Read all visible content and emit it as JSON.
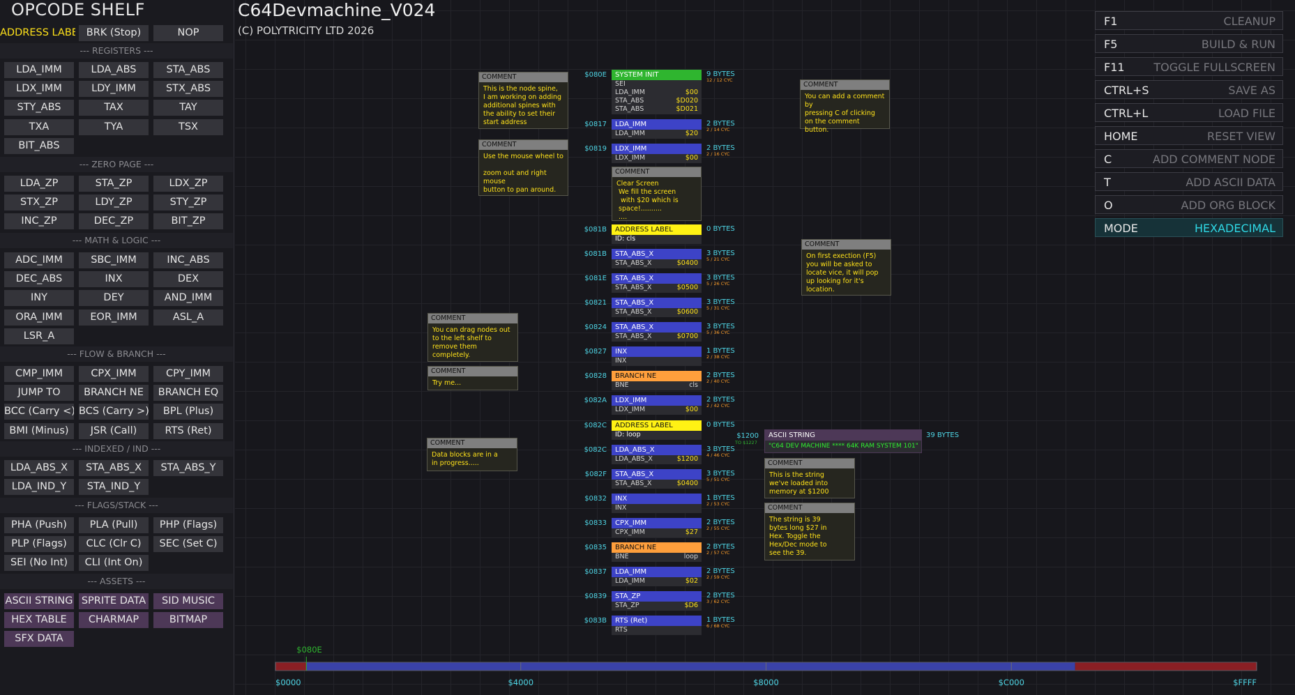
{
  "shelf": {
    "title": "OPCODE SHELF",
    "top": [
      "ADDRESS LABEL",
      "BRK (Stop)",
      "NOP"
    ],
    "sections": {
      "registers": "--- REGISTERS ---",
      "zeropage": "--- ZERO PAGE ---",
      "math": "--- MATH & LOGIC ---",
      "flow": "--- FLOW & BRANCH ---",
      "indexed": "--- INDEXED / IND ---",
      "flags": "--- FLAGS/STACK ---",
      "assets": "--- ASSETS ---"
    },
    "registers": [
      "LDA_IMM",
      "LDA_ABS",
      "STA_ABS",
      "LDX_IMM",
      "LDY_IMM",
      "STX_ABS",
      "STY_ABS",
      "TAX",
      "TAY",
      "TXA",
      "TYA",
      "TSX",
      "BIT_ABS"
    ],
    "zeropage": [
      "LDA_ZP",
      "STA_ZP",
      "LDX_ZP",
      "STX_ZP",
      "LDY_ZP",
      "STY_ZP",
      "INC_ZP",
      "DEC_ZP",
      "BIT_ZP"
    ],
    "math": [
      "ADC_IMM",
      "SBC_IMM",
      "INC_ABS",
      "DEC_ABS",
      "INX",
      "DEX",
      "INY",
      "DEY",
      "AND_IMM",
      "ORA_IMM",
      "EOR_IMM",
      "ASL_A",
      "LSR_A"
    ],
    "flow": [
      "CMP_IMM",
      "CPX_IMM",
      "CPY_IMM",
      "JUMP TO",
      "BRANCH NE",
      "BRANCH EQ",
      "BCC (Carry <)",
      "BCS (Carry >)",
      "BPL (Plus)",
      "BMI (Minus)",
      "JSR (Call)",
      "RTS (Ret)"
    ],
    "indexed": [
      "LDA_ABS_X",
      "STA_ABS_X",
      "STA_ABS_Y",
      "LDA_IND_Y",
      "STA_IND_Y"
    ],
    "flags": [
      "PHA (Push)",
      "PLA (Pull)",
      "PHP (Flags)",
      "PLP (Flags)",
      "CLC (Clr C)",
      "SEC (Set C)",
      "SEI (No Int)",
      "CLI (Int On)"
    ],
    "assets": [
      "ASCII STRING",
      "SPRITE DATA",
      "SID MUSIC",
      "HEX TABLE",
      "CHARMAP",
      "BITMAP",
      "SFX DATA"
    ]
  },
  "project": {
    "title": "C64Devmachine_V024",
    "subtitle": "(C) POLYTRICITY LTD 2026"
  },
  "spine": [
    {
      "addr": "$080E",
      "hdr": "SYSTEM INIT",
      "rows": [
        [
          "SEI",
          ""
        ],
        [
          "LDA_IMM",
          "$00"
        ],
        [
          "STA_ABS",
          "$D020"
        ],
        [
          "STA_ABS",
          "$D021"
        ]
      ],
      "bytes": "9 BYTES",
      "cyc": "12 / 12 CYC"
    },
    {
      "addr": "$0817",
      "hdr": "LDA_IMM",
      "rows": [
        [
          "LDA_IMM",
          "$20"
        ]
      ],
      "bytes": "2 BYTES",
      "cyc": "2 / 14 CYC"
    },
    {
      "addr": "$0819",
      "hdr": "LDX_IMM",
      "rows": [
        [
          "LDX_IMM",
          "$00"
        ]
      ],
      "bytes": "2 BYTES",
      "cyc": "2 / 16 CYC"
    },
    {
      "addr": "$081B",
      "hdr": "ADDRESS LABEL",
      "rows": [
        [
          "ID: cls",
          ""
        ]
      ],
      "bytes": "0 BYTES",
      "cyc": ""
    },
    {
      "addr": "$081B",
      "hdr": "STA_ABS_X",
      "rows": [
        [
          "STA_ABS_X",
          "$0400"
        ]
      ],
      "bytes": "3 BYTES",
      "cyc": "5 / 21 CYC"
    },
    {
      "addr": "$081E",
      "hdr": "STA_ABS_X",
      "rows": [
        [
          "STA_ABS_X",
          "$0500"
        ]
      ],
      "bytes": "3 BYTES",
      "cyc": "5 / 26 CYC"
    },
    {
      "addr": "$0821",
      "hdr": "STA_ABS_X",
      "rows": [
        [
          "STA_ABS_X",
          "$0600"
        ]
      ],
      "bytes": "3 BYTES",
      "cyc": "5 / 31 CYC"
    },
    {
      "addr": "$0824",
      "hdr": "STA_ABS_X",
      "rows": [
        [
          "STA_ABS_X",
          "$0700"
        ]
      ],
      "bytes": "3 BYTES",
      "cyc": "5 / 36 CYC"
    },
    {
      "addr": "$0827",
      "hdr": "INX",
      "rows": [
        [
          "INX",
          ""
        ]
      ],
      "bytes": "1 BYTES",
      "cyc": "2 / 38 CYC"
    },
    {
      "addr": "$0828",
      "hdr": "BRANCH NE",
      "rows": [
        [
          "BNE",
          "cls"
        ]
      ],
      "bytes": "2 BYTES",
      "cyc": "2 / 40 CYC"
    },
    {
      "addr": "$082A",
      "hdr": "LDX_IMM",
      "rows": [
        [
          "LDX_IMM",
          "$00"
        ]
      ],
      "bytes": "2 BYTES",
      "cyc": "2 / 42 CYC"
    },
    {
      "addr": "$082C",
      "hdr": "ADDRESS LABEL",
      "rows": [
        [
          "ID: loop",
          ""
        ]
      ],
      "bytes": "0 BYTES",
      "cyc": ""
    },
    {
      "addr": "$082C",
      "hdr": "LDA_ABS_X",
      "rows": [
        [
          "LDA_ABS_X",
          "$1200"
        ]
      ],
      "bytes": "3 BYTES",
      "cyc": "4 / 46 CYC"
    },
    {
      "addr": "$082F",
      "hdr": "STA_ABS_X",
      "rows": [
        [
          "STA_ABS_X",
          "$0400"
        ]
      ],
      "bytes": "3 BYTES",
      "cyc": "5 / 51 CYC"
    },
    {
      "addr": "$0832",
      "hdr": "INX",
      "rows": [
        [
          "INX",
          ""
        ]
      ],
      "bytes": "1 BYTES",
      "cyc": "2 / 53 CYC"
    },
    {
      "addr": "$0833",
      "hdr": "CPX_IMM",
      "rows": [
        [
          "CPX_IMM",
          "$27"
        ]
      ],
      "bytes": "2 BYTES",
      "cyc": "2 / 55 CYC"
    },
    {
      "addr": "$0835",
      "hdr": "BRANCH NE",
      "rows": [
        [
          "BNE",
          "loop"
        ]
      ],
      "bytes": "2 BYTES",
      "cyc": "2 / 57 CYC"
    },
    {
      "addr": "$0837",
      "hdr": "LDA_IMM",
      "rows": [
        [
          "LDA_IMM",
          "$02"
        ]
      ],
      "bytes": "2 BYTES",
      "cyc": "2 / 59 CYC"
    },
    {
      "addr": "$0839",
      "hdr": "STA_ZP",
      "rows": [
        [
          "STA_ZP",
          "$D6"
        ]
      ],
      "bytes": "2 BYTES",
      "cyc": "3 / 62 CYC"
    },
    {
      "addr": "$083B",
      "hdr": "RTS (Ret)",
      "rows": [
        [
          "RTS",
          ""
        ]
      ],
      "bytes": "1 BYTES",
      "cyc": "6 / 68 CYC"
    }
  ],
  "inline_comment": {
    "label": "COMMENT",
    "text": "Clear Screen\n We fill the screen\n  with $20 which is\n space!..........\n ...."
  },
  "comments": [
    {
      "label": "COMMENT",
      "text": "This is the node spine,\nI am working on adding\nadditional spines with\nthe ability to set their\nstart address"
    },
    {
      "label": "COMMENT",
      "text": "Use the mouse wheel to\n\nzoom out and right\nmouse\nbutton to pan around."
    },
    {
      "label": "COMMENT",
      "text": "You can add a comment\nby\npressing C of clicking\non the comment button."
    },
    {
      "label": "COMMENT",
      "text": "On first exection (F5)\nyou will be asked to\nlocate vice, it will pop\nup looking for it's\nlocation."
    },
    {
      "label": "COMMENT",
      "text": "You can drag nodes out\nto the left shelf to\nremove them\ncompletely."
    },
    {
      "label": "COMMENT",
      "text": "Try me..."
    },
    {
      "label": "COMMENT",
      "text": "Data blocks are in a\nin progress....."
    },
    {
      "label": "COMMENT",
      "text": "This is the string\nwe've loaded into\nmemory at $1200"
    },
    {
      "label": "COMMENT",
      "text": "The string is 39\nbytes long $27 in\nHex. Toggle the\nHex/Dec mode to\nsee the 39."
    }
  ],
  "ascii_node": {
    "addr": "$1200",
    "to": "TO $1227",
    "hdr": "ASCII STRING",
    "value": "\"C64 DEV MACHINE **** 64K RAM SYSTEM 101\"",
    "bytes": "39 BYTES"
  },
  "shortcuts": [
    {
      "key": "F1",
      "desc": "CLEANUP"
    },
    {
      "key": "F5",
      "desc": "BUILD & RUN"
    },
    {
      "key": "F11",
      "desc": "TOGGLE FULLSCREEN"
    },
    {
      "key": "CTRL+S",
      "desc": "SAVE AS"
    },
    {
      "key": "CTRL+L",
      "desc": "LOAD FILE"
    },
    {
      "key": "HOME",
      "desc": "RESET VIEW"
    },
    {
      "key": "C",
      "desc": "ADD COMMENT NODE"
    },
    {
      "key": "T",
      "desc": "ADD ASCII DATA"
    },
    {
      "key": "O",
      "desc": "ADD ORG BLOCK"
    }
  ],
  "mode": {
    "key": "MODE",
    "value": "HEXADECIMAL"
  },
  "memory_map": {
    "marker": "$080E",
    "ticks": [
      "$0000",
      "$4000",
      "$8000",
      "$C000",
      "$FFFF"
    ],
    "used_start": "$080E",
    "high_start_fraction": 0.815,
    "colors": {
      "low": "#8a1f24",
      "code": "#3a42a8",
      "high": "#8a1f24"
    }
  },
  "colors": {
    "system_init": "#2fb52f",
    "opcode": "#3d43c7",
    "branch": "#ff9f3c",
    "address_label": "#fff214",
    "address_text": "#4fd6e6",
    "value_text": "#ffe21a",
    "asset_button": "#4d3857"
  }
}
